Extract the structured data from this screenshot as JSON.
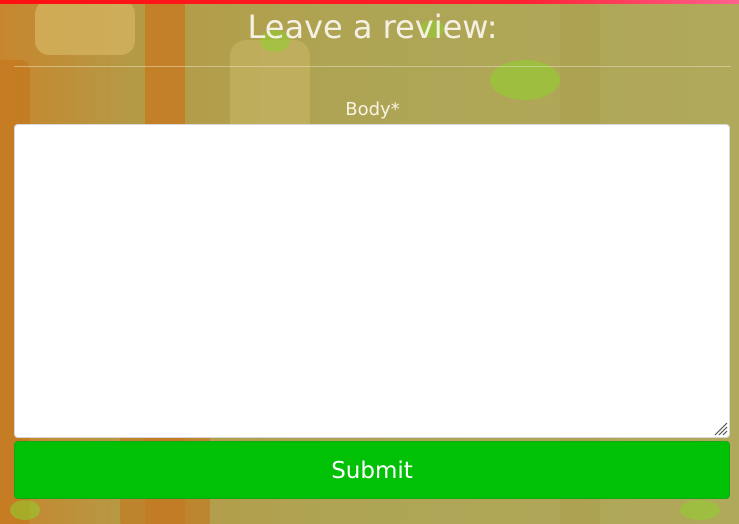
{
  "form": {
    "title": "Leave a review:",
    "body_label": "Body*",
    "body_value": "",
    "submit_label": "Submit"
  },
  "colors": {
    "top_bar": "#ff1010",
    "submit_bg": "#00c106",
    "text_light": "#f4f1e4"
  }
}
